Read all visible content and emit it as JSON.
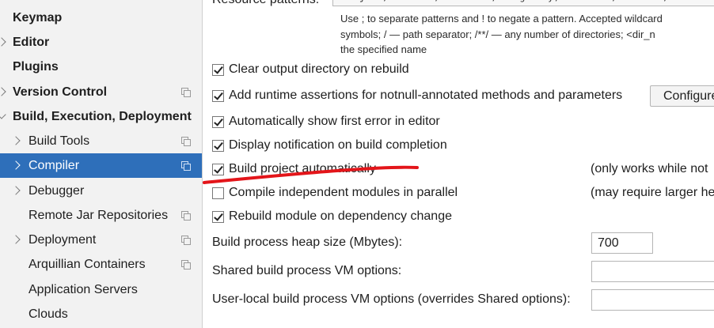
{
  "sidebar": {
    "items": [
      {
        "label": "Keymap",
        "level": "top",
        "arrow": "",
        "copy": false,
        "selected": false
      },
      {
        "label": "Editor",
        "level": "top",
        "arrow": "right",
        "copy": false,
        "selected": false
      },
      {
        "label": "Plugins",
        "level": "top",
        "arrow": "",
        "copy": false,
        "selected": false
      },
      {
        "label": "Version Control",
        "level": "top",
        "arrow": "right",
        "copy": true,
        "selected": false
      },
      {
        "label": "Build, Execution, Deployment",
        "level": "top",
        "arrow": "down",
        "copy": false,
        "selected": false
      },
      {
        "label": "Build Tools",
        "level": "child",
        "arrow": "right",
        "copy": true,
        "selected": false
      },
      {
        "label": "Compiler",
        "level": "child",
        "arrow": "right",
        "copy": true,
        "selected": true
      },
      {
        "label": "Debugger",
        "level": "child",
        "arrow": "right",
        "copy": false,
        "selected": false
      },
      {
        "label": "Remote Jar Repositories",
        "level": "child",
        "arrow": "",
        "copy": true,
        "selected": false
      },
      {
        "label": "Deployment",
        "level": "child",
        "arrow": "right",
        "copy": true,
        "selected": false
      },
      {
        "label": "Arquillian Containers",
        "level": "child",
        "arrow": "",
        "copy": true,
        "selected": false
      },
      {
        "label": "Application Servers",
        "level": "child",
        "arrow": "",
        "copy": false,
        "selected": false
      },
      {
        "label": "Clouds",
        "level": "child",
        "arrow": "",
        "copy": false,
        "selected": false
      }
    ]
  },
  "main": {
    "resource_patterns_label": "Resource patterns:",
    "resource_patterns_value": "!?*.java;!?*.form;!?*.class;!?*.groovy;!?*.scala;!?*.flex;!?*.kt",
    "hint_lines": [
      "Use ; to separate patterns and ! to negate a pattern. Accepted wildcard",
      "symbols; / — path separator; /**/ — any number of directories; <dir_n",
      "the specified name"
    ],
    "options": [
      {
        "label": "Clear output directory on rebuild",
        "checked": true,
        "note": ""
      },
      {
        "label": "Add runtime assertions for notnull-annotated methods and parameters",
        "checked": true,
        "note": ""
      },
      {
        "label": "Automatically show first error in editor",
        "checked": true,
        "note": ""
      },
      {
        "label": "Display notification on build completion",
        "checked": true,
        "note": ""
      },
      {
        "label": "Build project automatically",
        "checked": true,
        "note": "(only works while not"
      },
      {
        "label": "Compile independent modules in parallel",
        "checked": false,
        "note": "(may require larger he"
      },
      {
        "label": "Rebuild module on dependency change",
        "checked": true,
        "note": ""
      }
    ],
    "configure_button": "Configure",
    "heap_label": "Build process heap size (Mbytes):",
    "heap_value": "700",
    "shared_vm_label": "Shared build process VM options:",
    "shared_vm_value": "",
    "user_vm_label": "User-local build process VM options (overrides Shared options):",
    "user_vm_value": ""
  },
  "colors": {
    "selection": "#2e6fba",
    "annotation_stroke": "#e3151a"
  }
}
